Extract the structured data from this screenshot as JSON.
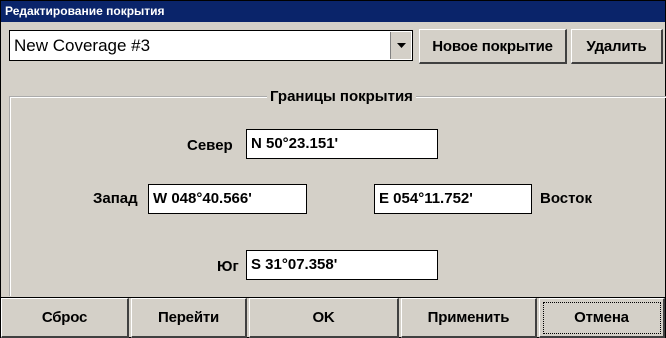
{
  "window": {
    "title": "Редактирование покрытия"
  },
  "coverage_select": {
    "value": "New Coverage #3",
    "arrow_icon": "chevron-down-icon"
  },
  "top_buttons": {
    "new_label": "Новое покрытие",
    "delete_label": "Удалить"
  },
  "bounds": {
    "title": "Границы покрытия",
    "north_label": "Север",
    "north_value": "N 50°23.151'",
    "west_label": "Запад",
    "west_value": "W 048°40.566'",
    "east_value": "E 054°11.752'",
    "east_label": "Восток",
    "south_label": "Юг",
    "south_value": "S 31°07.358'"
  },
  "bottom_buttons": {
    "reset_label": "Сброс",
    "goto_label": "Перейти",
    "ok_label": "OK",
    "apply_label": "Применить",
    "cancel_label": "Отмена"
  },
  "colors": {
    "titlebar": "#0a246a",
    "face": "#d4d0c8"
  }
}
